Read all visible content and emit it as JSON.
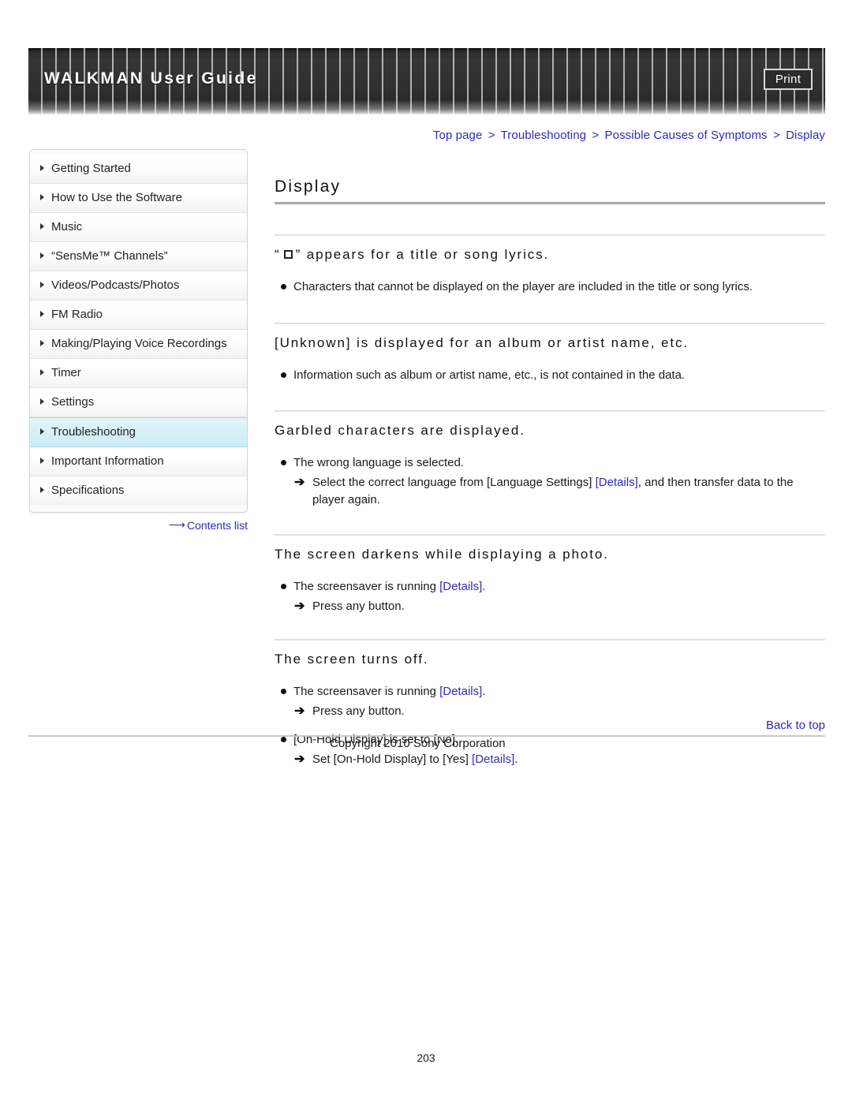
{
  "header": {
    "title": "WALKMAN User Guide",
    "print_label": "Print"
  },
  "breadcrumb": {
    "items": [
      "Top page",
      "Troubleshooting",
      "Possible Causes of Symptoms",
      "Display"
    ],
    "separator": ">"
  },
  "sidebar": {
    "items": [
      {
        "label": "Getting Started",
        "active": false
      },
      {
        "label": "How to Use the Software",
        "active": false
      },
      {
        "label": "Music",
        "active": false
      },
      {
        "label": "“SensMe™ Channels”",
        "active": false
      },
      {
        "label": "Videos/Podcasts/Photos",
        "active": false
      },
      {
        "label": "FM Radio",
        "active": false
      },
      {
        "label": "Making/Playing Voice Recordings",
        "active": false
      },
      {
        "label": "Timer",
        "active": false
      },
      {
        "label": "Settings",
        "active": false
      },
      {
        "label": "Troubleshooting",
        "active": true
      },
      {
        "label": "Important Information",
        "active": false
      },
      {
        "label": "Specifications",
        "active": false
      }
    ],
    "contents_list_label": "Contents list",
    "contents_list_arrow": "⟶"
  },
  "main": {
    "page_title": "Display",
    "sections": [
      {
        "title_prefix": "“",
        "title_has_box": true,
        "title_suffix": "” appears for a title or song lyrics.",
        "bullets": [
          {
            "text": "Characters that cannot be displayed on the player are included in the title or song lyrics."
          }
        ]
      },
      {
        "title": "[Unknown] is displayed for an album or artist name, etc.",
        "bullets": [
          {
            "text": "Information such as album or artist name, etc., is not contained in the data."
          }
        ]
      },
      {
        "title": "Garbled characters are displayed.",
        "bullets": [
          {
            "text": "The wrong language is selected."
          }
        ],
        "sub": [
          {
            "pre": "Select the correct language from [Language Settings] ",
            "link": "[Details]",
            "post": ", and then transfer data to the player again.",
            "arrow": "➔"
          }
        ]
      },
      {
        "title": "The screen darkens while displaying a photo.",
        "bullets": [
          {
            "pre": "The screensaver is running ",
            "link": "[Details]",
            "post": "."
          }
        ],
        "sub": [
          {
            "pre": "Press any button.",
            "link": "",
            "post": "",
            "arrow": "➔"
          }
        ]
      },
      {
        "title": "The screen turns off.",
        "bullets": [
          {
            "pre": "The screensaver is running ",
            "link": "[Details]",
            "post": "."
          }
        ],
        "sub": [
          {
            "pre": "Press any button.",
            "link": "",
            "post": "",
            "arrow": "➔"
          }
        ],
        "bullets2": [
          {
            "text": "[On-Hold Display] is set to [No]."
          }
        ],
        "sub2": [
          {
            "pre": "Set [On-Hold Display] to [Yes] ",
            "link": "[Details]",
            "post": ".",
            "arrow": "➔"
          }
        ]
      }
    ]
  },
  "footer": {
    "back_to_top": "Back to top",
    "copyright": "Copyright 2010 Sony Corporation",
    "page_number": "203"
  },
  "colors": {
    "link": "#2b2bbf",
    "active_nav": "#d3eff6",
    "banner_dark": "#303030",
    "rule": "#a8a8a8"
  }
}
